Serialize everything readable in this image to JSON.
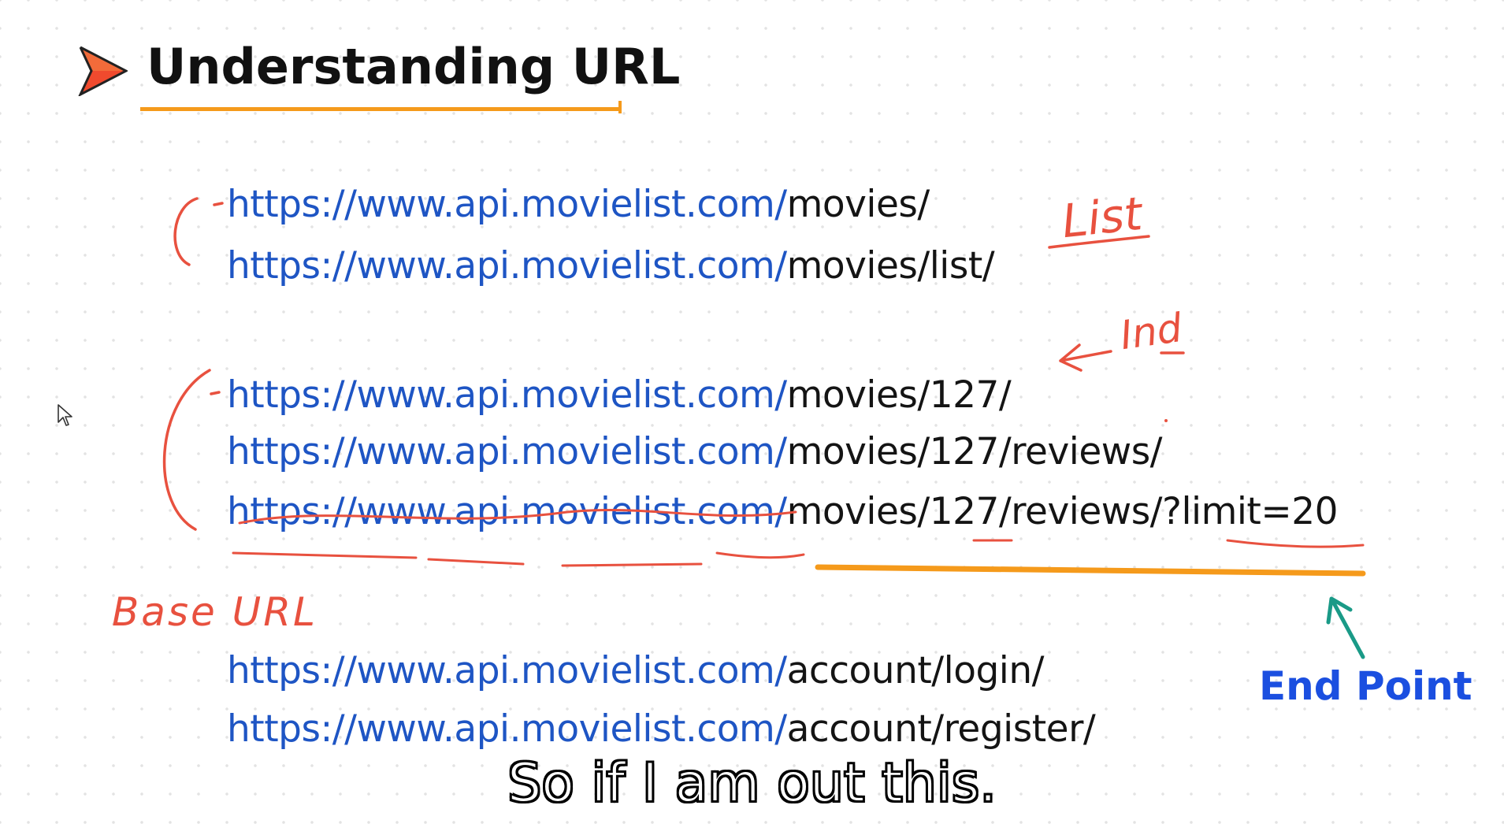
{
  "slide": {
    "title": "Understanding URL",
    "title_icon": "play-arrow-icon",
    "accent_color": "#f59a1b",
    "url_base_color": "#1e55c4"
  },
  "urls": [
    {
      "base": "https://www.api.movielist.com/",
      "path": "movies/"
    },
    {
      "base": "https://www.api.movielist.com/",
      "path": "movies/list/"
    },
    {
      "base": "https://www.api.movielist.com/",
      "path": "movies/127/"
    },
    {
      "base": "https://www.api.movielist.com/",
      "path": "movies/127/reviews/"
    },
    {
      "base": "https://www.api.movielist.com/",
      "path": "movies/127/reviews/?limit=20"
    },
    {
      "base": "https://www.api.movielist.com/",
      "path": "account/login/"
    },
    {
      "base": "https://www.api.movielist.com/",
      "path": "account/register/"
    }
  ],
  "annotations": {
    "list": "List",
    "ind": "Ind",
    "base_url": "Base URL",
    "end_point": "End Point",
    "handwriting_color": "#e8513f",
    "end_point_color": "#1b4fe0",
    "arrow_color": "#1a9a87"
  },
  "subtitle": "So if I am out this.",
  "cursor_icon": "mouse-pointer-icon"
}
